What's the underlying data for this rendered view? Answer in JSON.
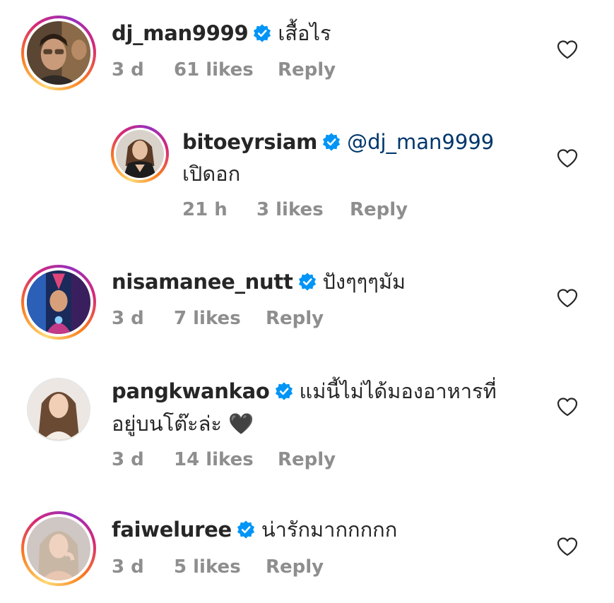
{
  "comments": [
    {
      "username": "dj_man9999",
      "text": "เสื้อไร",
      "time": "3 d",
      "likes": "61 likes",
      "reply": "Reply"
    },
    {
      "username": "bitoeyrsiam",
      "mention": "@dj_man9999",
      "text": "เปิดอก",
      "time": "21 h",
      "likes": "3 likes",
      "reply": "Reply"
    },
    {
      "username": "nisamanee_nutt",
      "text": "ปังๆๆๆมัม",
      "time": "3 d",
      "likes": "7 likes",
      "reply": "Reply"
    },
    {
      "username": "pangkwankao",
      "text": "แม่นี้ไม่ได้มองอาหารที่",
      "text_line2": "อยู่บนโต๊ะล่ะ 🖤",
      "time": "3 d",
      "likes": "14 likes",
      "reply": "Reply"
    },
    {
      "username": "faiweluree",
      "text": "น่ารักมากกกกก",
      "time": "3 d",
      "likes": "5 likes",
      "reply": "Reply"
    }
  ],
  "icons": {
    "verified": "verified-badge-icon",
    "like": "heart-outline-icon"
  },
  "colors": {
    "verified_blue": "#0095f6",
    "meta_gray": "#8e8e8e",
    "mention_blue": "#00376b",
    "text_dark": "#262626"
  }
}
